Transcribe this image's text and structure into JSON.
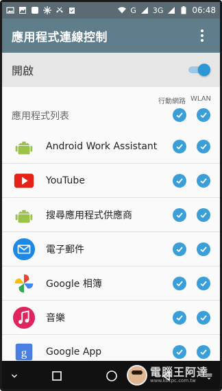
{
  "status_bar": {
    "network_labels": [
      "G",
      "3G"
    ],
    "time": "06:48"
  },
  "app_bar": {
    "title": "應用程式連線控制"
  },
  "master_toggle": {
    "label": "開啟",
    "state": "on"
  },
  "list": {
    "column_headers": [
      "行動網路",
      "WLAN"
    ],
    "section_title": "應用程式列表",
    "items": [
      {
        "name": "Android Work Assistant",
        "icon": "android-icon",
        "mobile_checked": true,
        "wlan_checked": true
      },
      {
        "name": "YouTube",
        "icon": "youtube-icon",
        "mobile_checked": true,
        "wlan_checked": true
      },
      {
        "name": "搜尋應用程式供應商",
        "icon": "android-icon",
        "mobile_checked": true,
        "wlan_checked": true
      },
      {
        "name": "電子郵件",
        "icon": "email-icon",
        "mobile_checked": true,
        "wlan_checked": true
      },
      {
        "name": "Google 相簿",
        "icon": "google-photos-icon",
        "mobile_checked": true,
        "wlan_checked": true
      },
      {
        "name": "音樂",
        "icon": "music-icon",
        "mobile_checked": true,
        "wlan_checked": true
      },
      {
        "name": "Google App",
        "icon": "google-app-icon",
        "mobile_checked": true,
        "wlan_checked": true
      }
    ]
  },
  "watermark": {
    "text": "電腦王阿達",
    "url": "www.kocpc.com.tw"
  },
  "colors": {
    "status_bar": "#5a6b74",
    "app_bar": "#607d8b",
    "accent": "#3a9fd8",
    "toggle_row_bg": "#e6e6e6"
  }
}
